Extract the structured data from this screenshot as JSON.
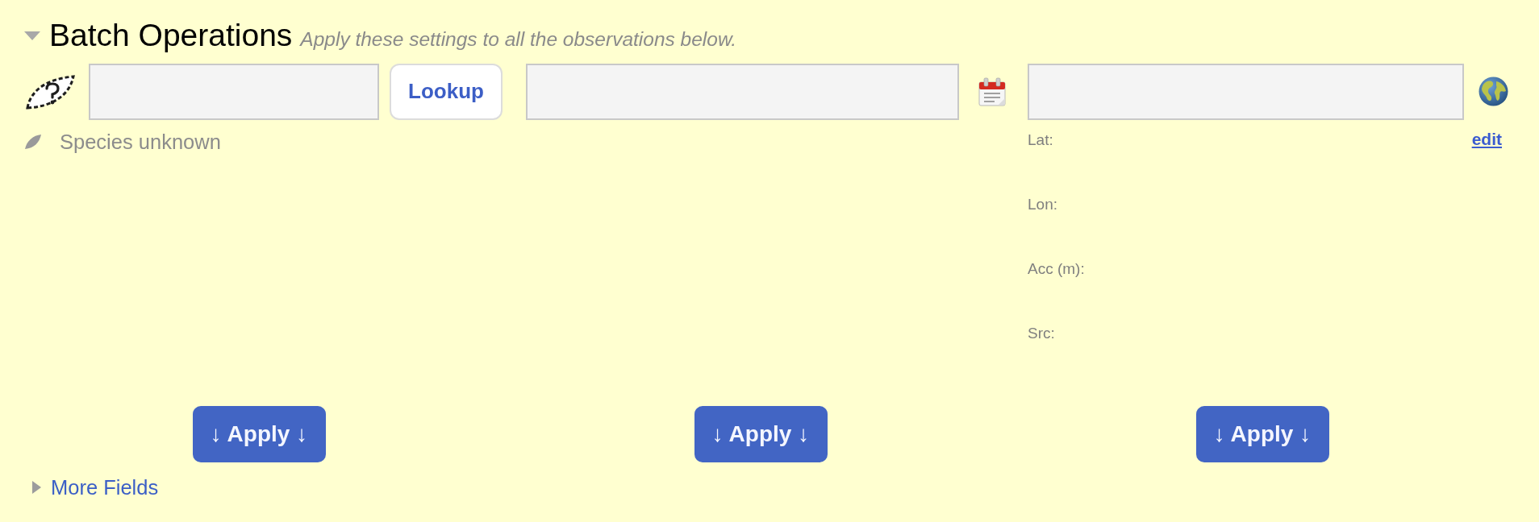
{
  "section": {
    "title": "Batch Operations",
    "subtitle": "Apply these settings to all the observations below.",
    "expanded": true
  },
  "columns": [
    {
      "kind": "taxon",
      "lookup_button": "Lookup",
      "status": "Species unknown",
      "apply_button": "↓ Apply ↓"
    },
    {
      "kind": "date",
      "apply_button": "↓ Apply ↓"
    },
    {
      "kind": "place",
      "edit_link": "edit",
      "details": [
        {
          "label": "Lat:"
        },
        {
          "label": "Lon:"
        },
        {
          "label": "Acc (m):"
        },
        {
          "label": "Src:"
        }
      ],
      "apply_button": "↓ Apply ↓"
    }
  ],
  "more_fields": {
    "label": "More Fields",
    "expanded": false
  }
}
